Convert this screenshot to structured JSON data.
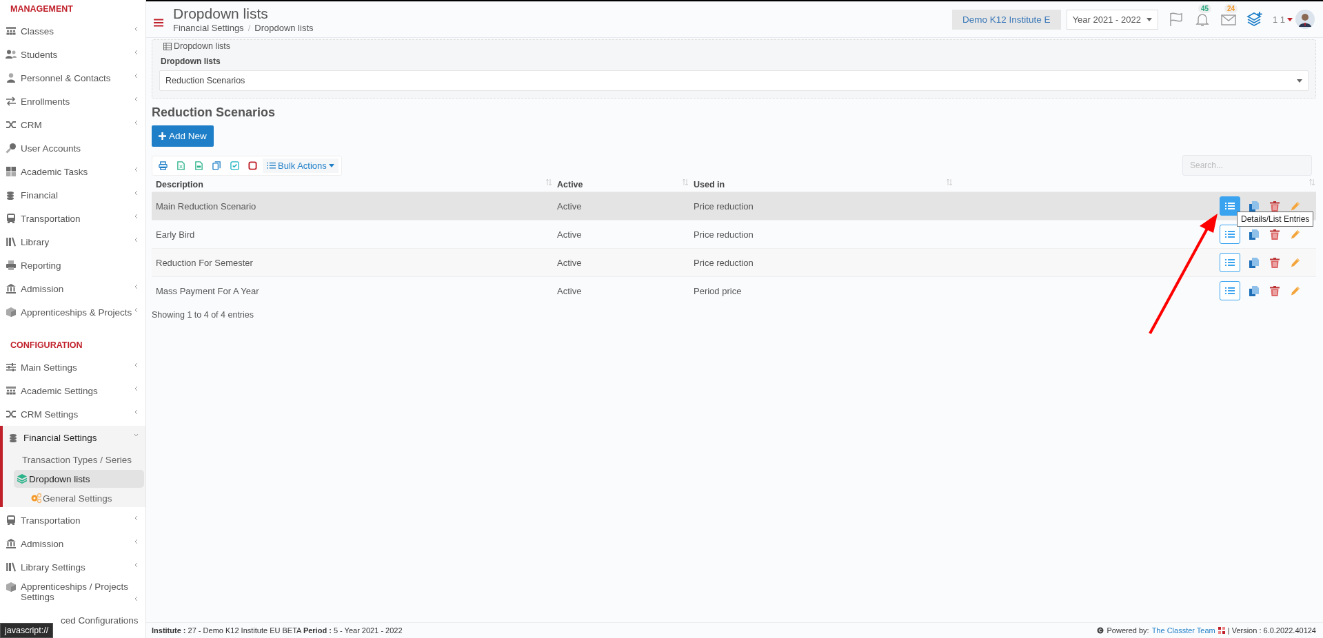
{
  "sidebar": {
    "sections": [
      {
        "title": "MANAGEMENT",
        "items": [
          {
            "label": "Classes",
            "kind": "group",
            "expanded": false,
            "selected": false
          },
          {
            "label": "Students",
            "kind": "group",
            "expanded": false,
            "selected": false
          },
          {
            "label": "Personnel & Contacts",
            "kind": "group",
            "expanded": false,
            "selected": false
          },
          {
            "label": "Enrollments",
            "kind": "group",
            "expanded": false,
            "selected": false
          },
          {
            "label": "CRM",
            "kind": "group",
            "expanded": false,
            "selected": false
          },
          {
            "label": "User Accounts",
            "kind": "link",
            "expanded": false,
            "selected": false
          },
          {
            "label": "Academic Tasks",
            "kind": "group",
            "expanded": false,
            "selected": false
          },
          {
            "label": "Financial",
            "kind": "group",
            "expanded": false,
            "selected": false
          },
          {
            "label": "Transportation",
            "kind": "group",
            "expanded": false,
            "selected": false
          },
          {
            "label": "Library",
            "kind": "group",
            "expanded": false,
            "selected": false
          },
          {
            "label": "Reporting",
            "kind": "link",
            "expanded": false,
            "selected": false
          },
          {
            "label": "Admission",
            "kind": "group",
            "expanded": false,
            "selected": false
          },
          {
            "label": "Apprenticeships & Projects",
            "kind": "group",
            "expanded": false,
            "selected": false
          }
        ]
      },
      {
        "title": "CONFIGURATION",
        "items": [
          {
            "label": "Main Settings",
            "kind": "group",
            "expanded": false,
            "selected": false
          },
          {
            "label": "Academic Settings",
            "kind": "group",
            "expanded": false,
            "selected": false
          },
          {
            "label": "CRM Settings",
            "kind": "group",
            "expanded": false,
            "selected": false
          },
          {
            "label": "Financial Settings",
            "kind": "group",
            "expanded": true,
            "selected": false,
            "children": [
              {
                "label": "Transaction Types / Series",
                "selected": false
              },
              {
                "label": "Dropdown lists",
                "selected": true
              },
              {
                "label": "General Settings",
                "selected": false
              }
            ]
          },
          {
            "label": "Transportation",
            "kind": "group",
            "expanded": false,
            "selected": false
          },
          {
            "label": "Admission",
            "kind": "group",
            "expanded": false,
            "selected": false
          },
          {
            "label": "Library Settings",
            "kind": "group",
            "expanded": false,
            "selected": false
          },
          {
            "label": "Apprenticeships / Projects Settings",
            "kind": "group",
            "expanded": false,
            "selected": false
          },
          {
            "label": "ced Configurations",
            "kind": "partial",
            "expanded": false,
            "selected": false
          }
        ]
      }
    ]
  },
  "status_tooltip": "javascript://",
  "header": {
    "title": "Dropdown lists",
    "breadcrumbs": [
      "Financial Settings",
      "Dropdown lists"
    ],
    "breadcrumb_separator": "/",
    "institute": "Demo K12 Institute E",
    "year": "Year 2021 - 2022",
    "notifications": "45",
    "messages": "24",
    "user": "1 1"
  },
  "filter_panel": {
    "legend": "Dropdown lists",
    "label": "Dropdown lists",
    "value": "Reduction Scenarios"
  },
  "section_title": "Reduction Scenarios",
  "add_button": "Add New",
  "bulk_actions": "Bulk Actions",
  "search": {
    "placeholder": "Search..."
  },
  "table": {
    "columns": [
      "Description",
      "Active",
      "Used in"
    ],
    "rows": [
      {
        "cells": [
          "Main Reduction Scenario",
          "Active",
          "Price reduction"
        ],
        "selected": true
      },
      {
        "cells": [
          "Early Bird",
          "Active",
          "Price reduction"
        ],
        "selected": false
      },
      {
        "cells": [
          "Reduction For Semester",
          "Active",
          "Price reduction"
        ],
        "selected": false
      },
      {
        "cells": [
          "Mass Payment For A Year",
          "Active",
          "Period price"
        ],
        "selected": false
      }
    ]
  },
  "entries_info": "Showing 1 to 4 of 4 entries",
  "tooltip": "Details/List Entries",
  "footer": {
    "left": "**Institute :** 27 - Demo K12 Institute EU BETA **Period :** 5 - Year 2021 - 2022",
    "powered_label": "Powered by:",
    "powered_link": "The Classter Team",
    "version": "| Version : 6.0.2022.40124"
  }
}
